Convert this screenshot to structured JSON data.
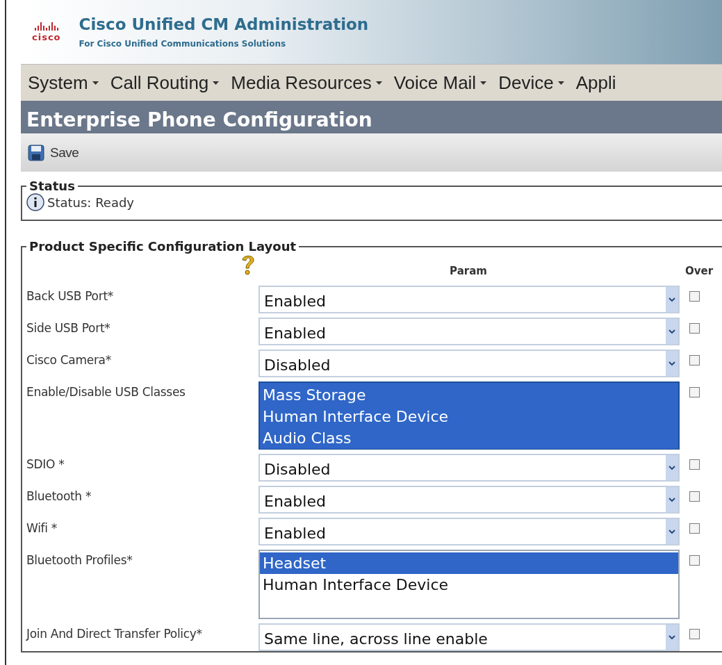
{
  "header": {
    "logo_text": "cisco",
    "title": "Cisco Unified CM Administration",
    "subtitle": "For Cisco Unified Communications Solutions"
  },
  "menu": [
    {
      "label": "System",
      "dropdown": true
    },
    {
      "label": "Call Routing",
      "dropdown": true
    },
    {
      "label": "Media Resources",
      "dropdown": true
    },
    {
      "label": "Voice Mail",
      "dropdown": true
    },
    {
      "label": "Device",
      "dropdown": true
    },
    {
      "label": "Appli",
      "dropdown": false
    }
  ],
  "page_title": "Enterprise Phone Configuration",
  "toolbar": [
    {
      "label": "Save"
    }
  ],
  "status": {
    "legend": "Status",
    "message": "Status: Ready"
  },
  "config": {
    "legend": "Product Specific Configuration Layout",
    "columns": [
      "Param",
      "Over"
    ],
    "rows": [
      {
        "label": "Back USB Port*",
        "kind": "select",
        "value": "Enabled",
        "override": false
      },
      {
        "label": "Side USB Port*",
        "kind": "select",
        "value": "Enabled",
        "override": false
      },
      {
        "label": "Cisco Camera*",
        "kind": "select",
        "value": "Disabled",
        "override": false
      },
      {
        "label": "Enable/Disable USB Classes",
        "kind": "listbox",
        "options": [
          {
            "label": "Mass Storage",
            "selected": true
          },
          {
            "label": "Human Interface Device",
            "selected": true
          },
          {
            "label": "Audio Class",
            "selected": true
          }
        ],
        "override": false
      },
      {
        "label": "SDIO *",
        "kind": "select",
        "value": "Disabled",
        "override": false
      },
      {
        "label": "Bluetooth *",
        "kind": "select",
        "value": "Enabled",
        "override": false
      },
      {
        "label": "Wifi *",
        "kind": "select",
        "value": "Enabled",
        "override": false
      },
      {
        "label": "Bluetooth Profiles*",
        "kind": "listbox",
        "options": [
          {
            "label": "Headset",
            "selected": true
          },
          {
            "label": "Human Interface Device",
            "selected": false
          }
        ],
        "override": false
      },
      {
        "label": "Join And Direct Transfer Policy*",
        "kind": "select",
        "value": "Same line, across line enable",
        "override": false
      }
    ]
  }
}
